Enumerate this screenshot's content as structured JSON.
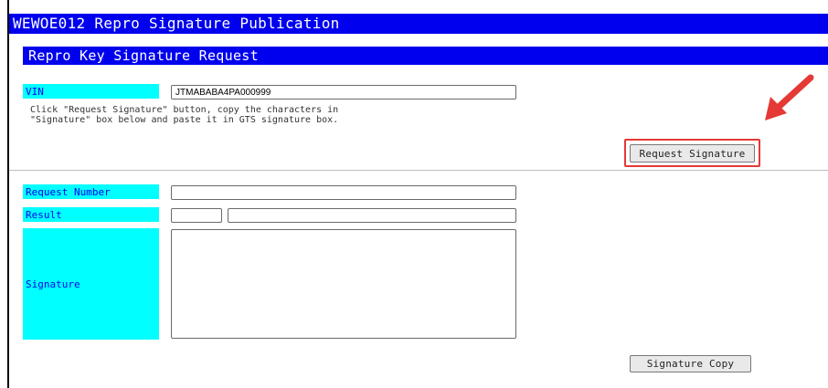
{
  "window": {
    "title": "WEWOE012 Repro Signature Publication"
  },
  "section": {
    "title": "Repro Key Signature Request"
  },
  "vin": {
    "label": "VIN",
    "value": "JTMABABA4PA000999"
  },
  "instructions": "Click \"Request Signature\" button, copy the characters in\n\"Signature\" box below and paste it in GTS signature box.",
  "buttons": {
    "request_signature": "Request Signature",
    "signature_copy": "Signature Copy"
  },
  "fields": {
    "request_number": {
      "label": "Request Number",
      "value": ""
    },
    "result": {
      "label": "Result",
      "code": "",
      "message": ""
    },
    "signature": {
      "label": "Signature",
      "value": ""
    }
  },
  "annotation": {
    "highlight_color": "#e53935",
    "arrow_icon": "red-arrow-icon"
  },
  "colors": {
    "title_bar": "#0000ee",
    "label_bg": "#00ffff",
    "label_text": "#0000ee"
  }
}
